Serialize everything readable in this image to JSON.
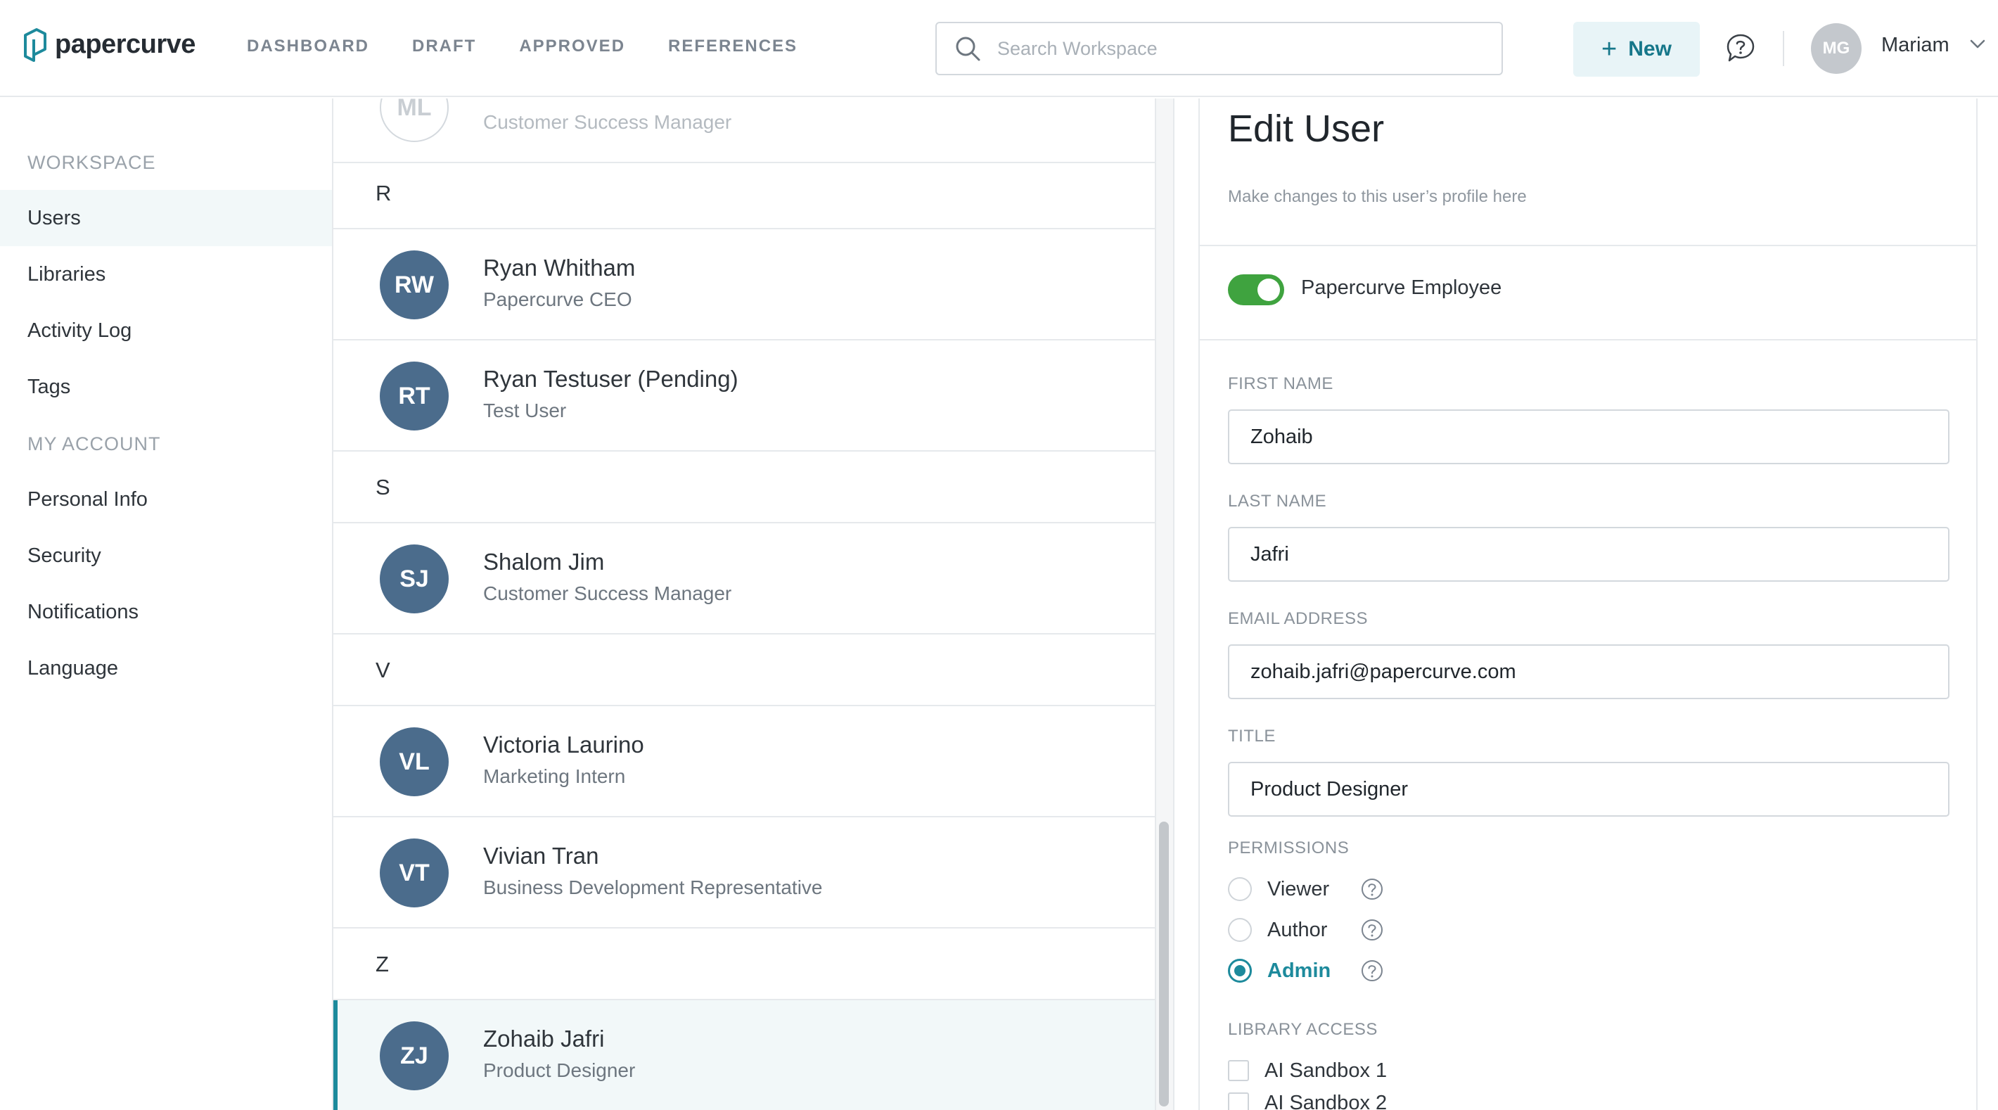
{
  "brand": {
    "name": "papercurve",
    "accent": "#1d8a9c"
  },
  "nav": [
    "DASHBOARD",
    "DRAFT",
    "APPROVED",
    "REFERENCES"
  ],
  "search": {
    "placeholder": "Search Workspace"
  },
  "header": {
    "new_label": "New",
    "avatar_initials": "MG",
    "user_name": "Mariam"
  },
  "sidebar": {
    "workspace_heading": "WORKSPACE",
    "workspace_items": [
      "Users",
      "Libraries",
      "Activity Log",
      "Tags"
    ],
    "account_heading": "MY ACCOUNT",
    "account_items": [
      "Personal Info",
      "Security",
      "Notifications",
      "Language"
    ],
    "active_item": "Users"
  },
  "user_list": {
    "partial_user": {
      "initials": "ML",
      "title": "Customer Success Manager"
    },
    "groups": [
      {
        "letter": "R",
        "users": [
          {
            "initials": "RW",
            "name": "Ryan Whitham",
            "title": "Papercurve CEO"
          },
          {
            "initials": "RT",
            "name": "Ryan Testuser (Pending)",
            "title": "Test User"
          }
        ]
      },
      {
        "letter": "S",
        "users": [
          {
            "initials": "SJ",
            "name": "Shalom Jim",
            "title": "Customer Success Manager"
          }
        ]
      },
      {
        "letter": "V",
        "users": [
          {
            "initials": "VL",
            "name": "Victoria Laurino",
            "title": "Marketing Intern"
          },
          {
            "initials": "VT",
            "name": "Vivian Tran",
            "title": "Business Development Representative"
          }
        ]
      },
      {
        "letter": "Z",
        "users": [
          {
            "initials": "ZJ",
            "name": "Zohaib Jafri",
            "title": "Product Designer",
            "selected": true
          }
        ]
      }
    ]
  },
  "edit_user": {
    "title": "Edit User",
    "subtitle": "Make changes to this user’s profile here",
    "employee_toggle_label": "Papercurve Employee",
    "employee_toggle_on": true,
    "fields": {
      "first_name": {
        "label": "FIRST NAME",
        "value": "Zohaib"
      },
      "last_name": {
        "label": "LAST NAME",
        "value": "Jafri"
      },
      "email": {
        "label": "EMAIL ADDRESS",
        "value": "zohaib.jafri@papercurve.com"
      },
      "title": {
        "label": "TITLE",
        "value": "Product Designer"
      }
    },
    "permissions": {
      "label": "PERMISSIONS",
      "options": [
        "Viewer",
        "Author",
        "Admin"
      ],
      "selected": "Admin"
    },
    "library_access": {
      "label": "LIBRARY ACCESS",
      "options": [
        "AI Sandbox 1",
        "AI Sandbox 2"
      ]
    }
  }
}
